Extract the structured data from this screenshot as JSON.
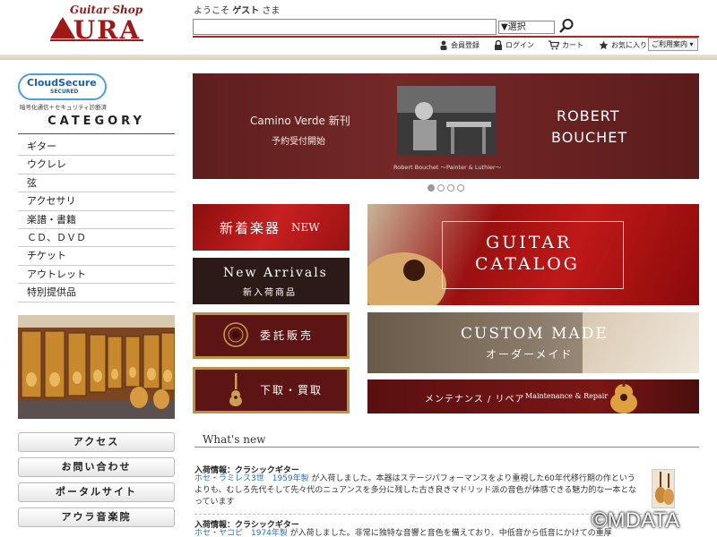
{
  "header": {
    "logo_sub": "Guitar Shop",
    "logo_main": "AURA",
    "welcome_prefix": "ようこそ",
    "welcome_user": "ゲスト",
    "welcome_suffix": "さま",
    "search_placeholder": "",
    "search_select": "▼選択",
    "nav": [
      "会員登録",
      "ログイン",
      "カート",
      "お気に入り"
    ],
    "guide": "ご利用案内 ▾"
  },
  "sidebar": {
    "security_badge": "CloudSecure",
    "security_badge_sub": "SECURED",
    "security_caption": "暗号化通信＋セキュリティ診断済",
    "category_title": "CATEGORY",
    "categories": [
      "ギター",
      "ウクレレ",
      "弦",
      "アクセサリ",
      "楽譜・書籍",
      "ＣＤ、ＤＶＤ",
      "チケット",
      "アウトレット",
      "特別提供品"
    ],
    "buttons": [
      "アクセス",
      "お問い合わせ",
      "ポータルサイト",
      "アウラ音楽院"
    ]
  },
  "hero": {
    "line1": "Camino Verde 新刊",
    "line2": "予約受付開始",
    "right1": "ROBERT",
    "right2": "BOUCHET",
    "caption": "Robert Bouchet ～Painter & Luthier～",
    "slide_count": 4,
    "active_slide": 1
  },
  "banners": {
    "new_jp": "新着楽器",
    "new_en": "NEW",
    "arrivals_en": "New Arrivals",
    "arrivals_jp": "新入荷商品",
    "itaku": "委託販売",
    "kaitori": "下取・買取",
    "catalog1": "GUITAR",
    "catalog2": "CATALOG",
    "custom_en": "CUSTOM MADE",
    "custom_jp": "オーダーメイド",
    "maint_jp": "メンテナンス / リペア",
    "maint_en": "Maintenance & Repair"
  },
  "whats_new": {
    "title": "What's new",
    "items": [
      {
        "head": "入荷情報：クラシックギター",
        "link": "ホセ・ラミレス3世　1959年製",
        "text": "が入荷しました。本器はステージパフォーマンスをより重視した60年代移行期の作というよりも、むしろ先代そして先々代のニュアンスを多分に残した古き良きマドリッド派の音色が体感できる魅力的な一本となっています"
      },
      {
        "head": "入荷情報：クラシックギター",
        "link": "ホセ・ヤコピ　1974年製",
        "text": "が入荷しました。非常に独特な音響と音色を備えており、中低音から低音にかけての重厚"
      }
    ]
  },
  "watermark": "©MDATA",
  "colors": {
    "brand_red": "#a01818",
    "link_blue": "#2a6fb8"
  }
}
